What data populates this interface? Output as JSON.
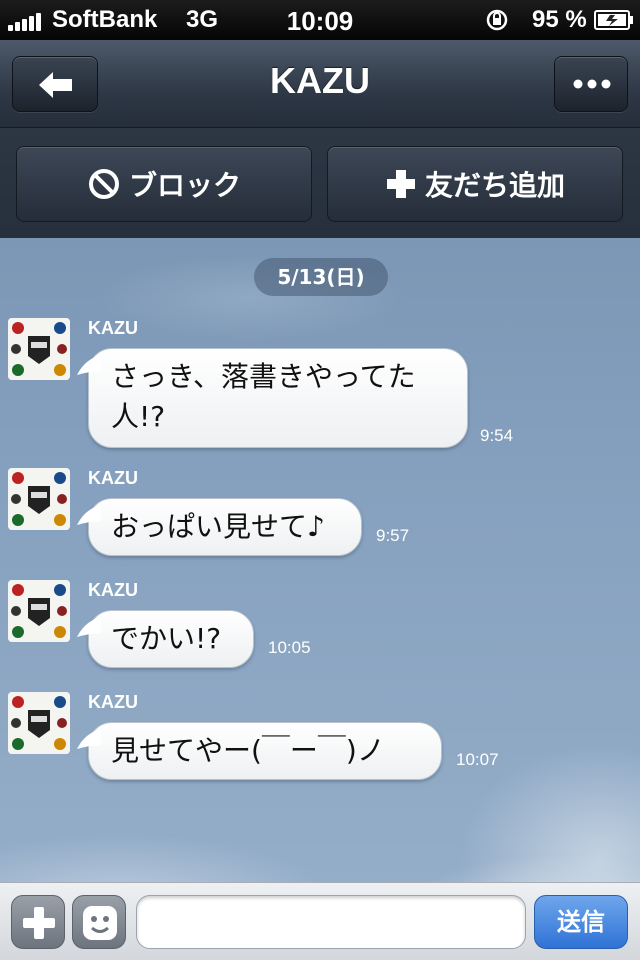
{
  "status_bar": {
    "carrier": "SoftBank",
    "network": "3G",
    "time": "10:09",
    "battery_percent": "95 %"
  },
  "header": {
    "title": "KAZU",
    "back_icon": "arrow-left-icon",
    "more_icon": "more-icon"
  },
  "actions": {
    "block_label": "ブロック",
    "add_friend_label": "友だち追加"
  },
  "chat": {
    "date": "5/13(日)",
    "messages": [
      {
        "sender": "KAZU",
        "text_lines": [
          "さっき、落書きやってた",
          "人!?"
        ],
        "time": "9:54"
      },
      {
        "sender": "KAZU",
        "text": "おっぱい見せて♪",
        "time": "9:57"
      },
      {
        "sender": "KAZU",
        "text": "でかい!?",
        "time": "10:05"
      },
      {
        "sender": "KAZU",
        "text": "見せてやー(￣ー￣)ノ",
        "time": "10:07"
      }
    ]
  },
  "input_bar": {
    "placeholder": "",
    "send_label": "送信"
  },
  "colors": {
    "chat_background": "#86a1bf",
    "header": "#2e3846",
    "send_button": "#2f73d6"
  }
}
